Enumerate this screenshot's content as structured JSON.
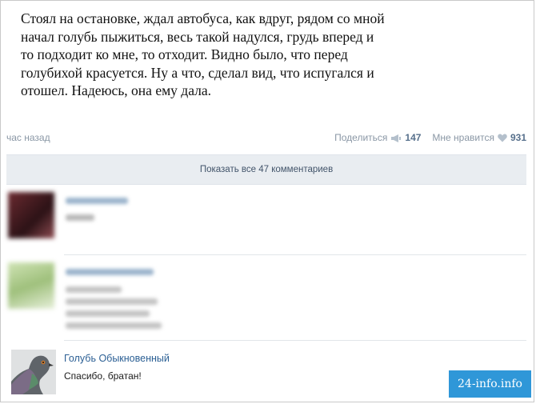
{
  "post": {
    "text": "Стоял на остановке, ждал автобуса, как вдруг, рядом со мной\nначал голубь пыжиться, весь такой надулся, грудь вперед и\nто подходит ко мне, то отходит. Видно было, что перед\nголубихой красуется. Ну а что, сделал вид, что испугался и\nотошел. Надеюсь, она ему дала.",
    "time": "час назад",
    "share_label": "Поделиться",
    "share_count": "147",
    "like_label": "Мне нравится",
    "like_count": "931"
  },
  "show_all_comments": "Показать все 47 комментариев",
  "comments": [
    {
      "name": "",
      "text": "",
      "blurred": true
    },
    {
      "name": "",
      "text": "",
      "blurred": true
    },
    {
      "name": "Голубь Обыкновенный",
      "text": "Спасибо, братан!"
    }
  ],
  "watermark": "24-info.info",
  "colors": {
    "link": "#2b5f94",
    "meta": "#8a97a5",
    "count": "#57708c",
    "bar": "#e9edf1",
    "watermark_bg": "#2f97d8"
  },
  "icons": [
    "megaphone-icon",
    "heart-icon"
  ]
}
